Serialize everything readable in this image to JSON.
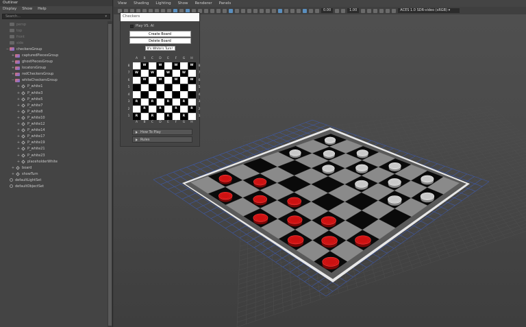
{
  "outliner": {
    "title": "Outliner",
    "menu": [
      "Display",
      "Show",
      "Help"
    ],
    "search_placeholder": "Search...",
    "nodes": [
      {
        "label": "persp",
        "indent": 0,
        "icon": "camera-icon",
        "dim": true,
        "exp": ""
      },
      {
        "label": "top",
        "indent": 0,
        "icon": "camera-icon",
        "dim": true,
        "exp": ""
      },
      {
        "label": "front",
        "indent": 0,
        "icon": "camera-icon",
        "dim": true,
        "exp": ""
      },
      {
        "label": "side",
        "indent": 0,
        "icon": "camera-icon",
        "dim": true,
        "exp": ""
      },
      {
        "label": "checkersGroup",
        "indent": 0,
        "icon": "group-icon",
        "dim": false,
        "exp": "−"
      },
      {
        "label": "capturedPiecesGroup",
        "indent": 1,
        "icon": "group-icon",
        "dim": false,
        "exp": "+"
      },
      {
        "label": "ghostPiecesGroup",
        "indent": 1,
        "icon": "group-icon",
        "dim": false,
        "exp": "+"
      },
      {
        "label": "locatorsGroup",
        "indent": 1,
        "icon": "group-icon",
        "dim": false,
        "exp": "+"
      },
      {
        "label": "redCheckersGroup",
        "indent": 1,
        "icon": "group-icon",
        "dim": false,
        "exp": "+"
      },
      {
        "label": "whiteCheckersGroup",
        "indent": 1,
        "icon": "group-icon",
        "dim": false,
        "exp": "−"
      },
      {
        "label": "P_white1",
        "indent": 2,
        "icon": "transform-icon",
        "dim": false,
        "exp": "+"
      },
      {
        "label": "P_white3",
        "indent": 2,
        "icon": "transform-icon",
        "dim": false,
        "exp": "+"
      },
      {
        "label": "P_white5",
        "indent": 2,
        "icon": "transform-icon",
        "dim": false,
        "exp": "+"
      },
      {
        "label": "P_white7",
        "indent": 2,
        "icon": "transform-icon",
        "dim": false,
        "exp": "+"
      },
      {
        "label": "P_white8",
        "indent": 2,
        "icon": "transform-icon",
        "dim": false,
        "exp": "+"
      },
      {
        "label": "P_white10",
        "indent": 2,
        "icon": "transform-icon",
        "dim": false,
        "exp": "+"
      },
      {
        "label": "P_white12",
        "indent": 2,
        "icon": "transform-icon",
        "dim": false,
        "exp": "+"
      },
      {
        "label": "P_white14",
        "indent": 2,
        "icon": "transform-icon",
        "dim": false,
        "exp": "+"
      },
      {
        "label": "P_white17",
        "indent": 2,
        "icon": "transform-icon",
        "dim": false,
        "exp": "+"
      },
      {
        "label": "P_white19",
        "indent": 2,
        "icon": "transform-icon",
        "dim": false,
        "exp": "+"
      },
      {
        "label": "P_white21",
        "indent": 2,
        "icon": "transform-icon",
        "dim": false,
        "exp": "+"
      },
      {
        "label": "P_white23",
        "indent": 2,
        "icon": "transform-icon",
        "dim": false,
        "exp": "+"
      },
      {
        "label": "placeholderWhite",
        "indent": 2,
        "icon": "transform-icon",
        "dim": false,
        "exp": "+"
      },
      {
        "label": "board",
        "indent": 1,
        "icon": "transform-icon",
        "dim": false,
        "exp": "+"
      },
      {
        "label": "showTurn",
        "indent": 1,
        "icon": "transform-icon",
        "dim": false,
        "exp": "+"
      },
      {
        "label": "defaultLightSet",
        "indent": 0,
        "icon": "set-icon",
        "dim": false,
        "exp": ""
      },
      {
        "label": "defaultObjectSet",
        "indent": 0,
        "icon": "set-icon",
        "dim": false,
        "exp": ""
      }
    ]
  },
  "viewport": {
    "menu": [
      "View",
      "Shading",
      "Lighting",
      "Show",
      "Renderer",
      "Panels"
    ],
    "field1": "0.00",
    "field2": "1.00",
    "colorspace": "ACES 1.0 SDR-video (sRGB)"
  },
  "checkers": {
    "title": "Checkers",
    "play_ai_label": "Play VS. AI",
    "create_label": "Create Board",
    "delete_label": "Delete Board",
    "turn_label": "It's White's Turn!",
    "files": [
      "A",
      "B",
      "C",
      "D",
      "E",
      "F",
      "G",
      "H"
    ],
    "ranks": [
      "8",
      "7",
      "6",
      "5",
      "4",
      "3",
      "2",
      "1"
    ],
    "board": [
      [
        "",
        "W",
        "",
        "W",
        "",
        "W",
        "",
        "W"
      ],
      [
        "W",
        "",
        "W",
        "",
        "W",
        "",
        "W",
        ""
      ],
      [
        "",
        "W",
        "",
        "W",
        "",
        "W",
        "",
        "W"
      ],
      [
        "",
        "",
        "",
        "",
        "",
        "",
        "",
        ""
      ],
      [
        "",
        "",
        "",
        "",
        "",
        "",
        "",
        ""
      ],
      [
        "R",
        "",
        "R",
        "",
        "R",
        "",
        "R",
        ""
      ],
      [
        "",
        "R",
        "",
        "R",
        "",
        "R",
        "",
        "R"
      ],
      [
        "R",
        "",
        "R",
        "",
        "R",
        "",
        "R",
        ""
      ]
    ],
    "how_to_play_label": "How To Play",
    "rules_label": "Rules"
  },
  "colors": {
    "red_piece": "#cc1111",
    "white_piece": "#c8c8c8",
    "board_dark": "#0a0a0a",
    "board_light": "#8a8a8a"
  }
}
